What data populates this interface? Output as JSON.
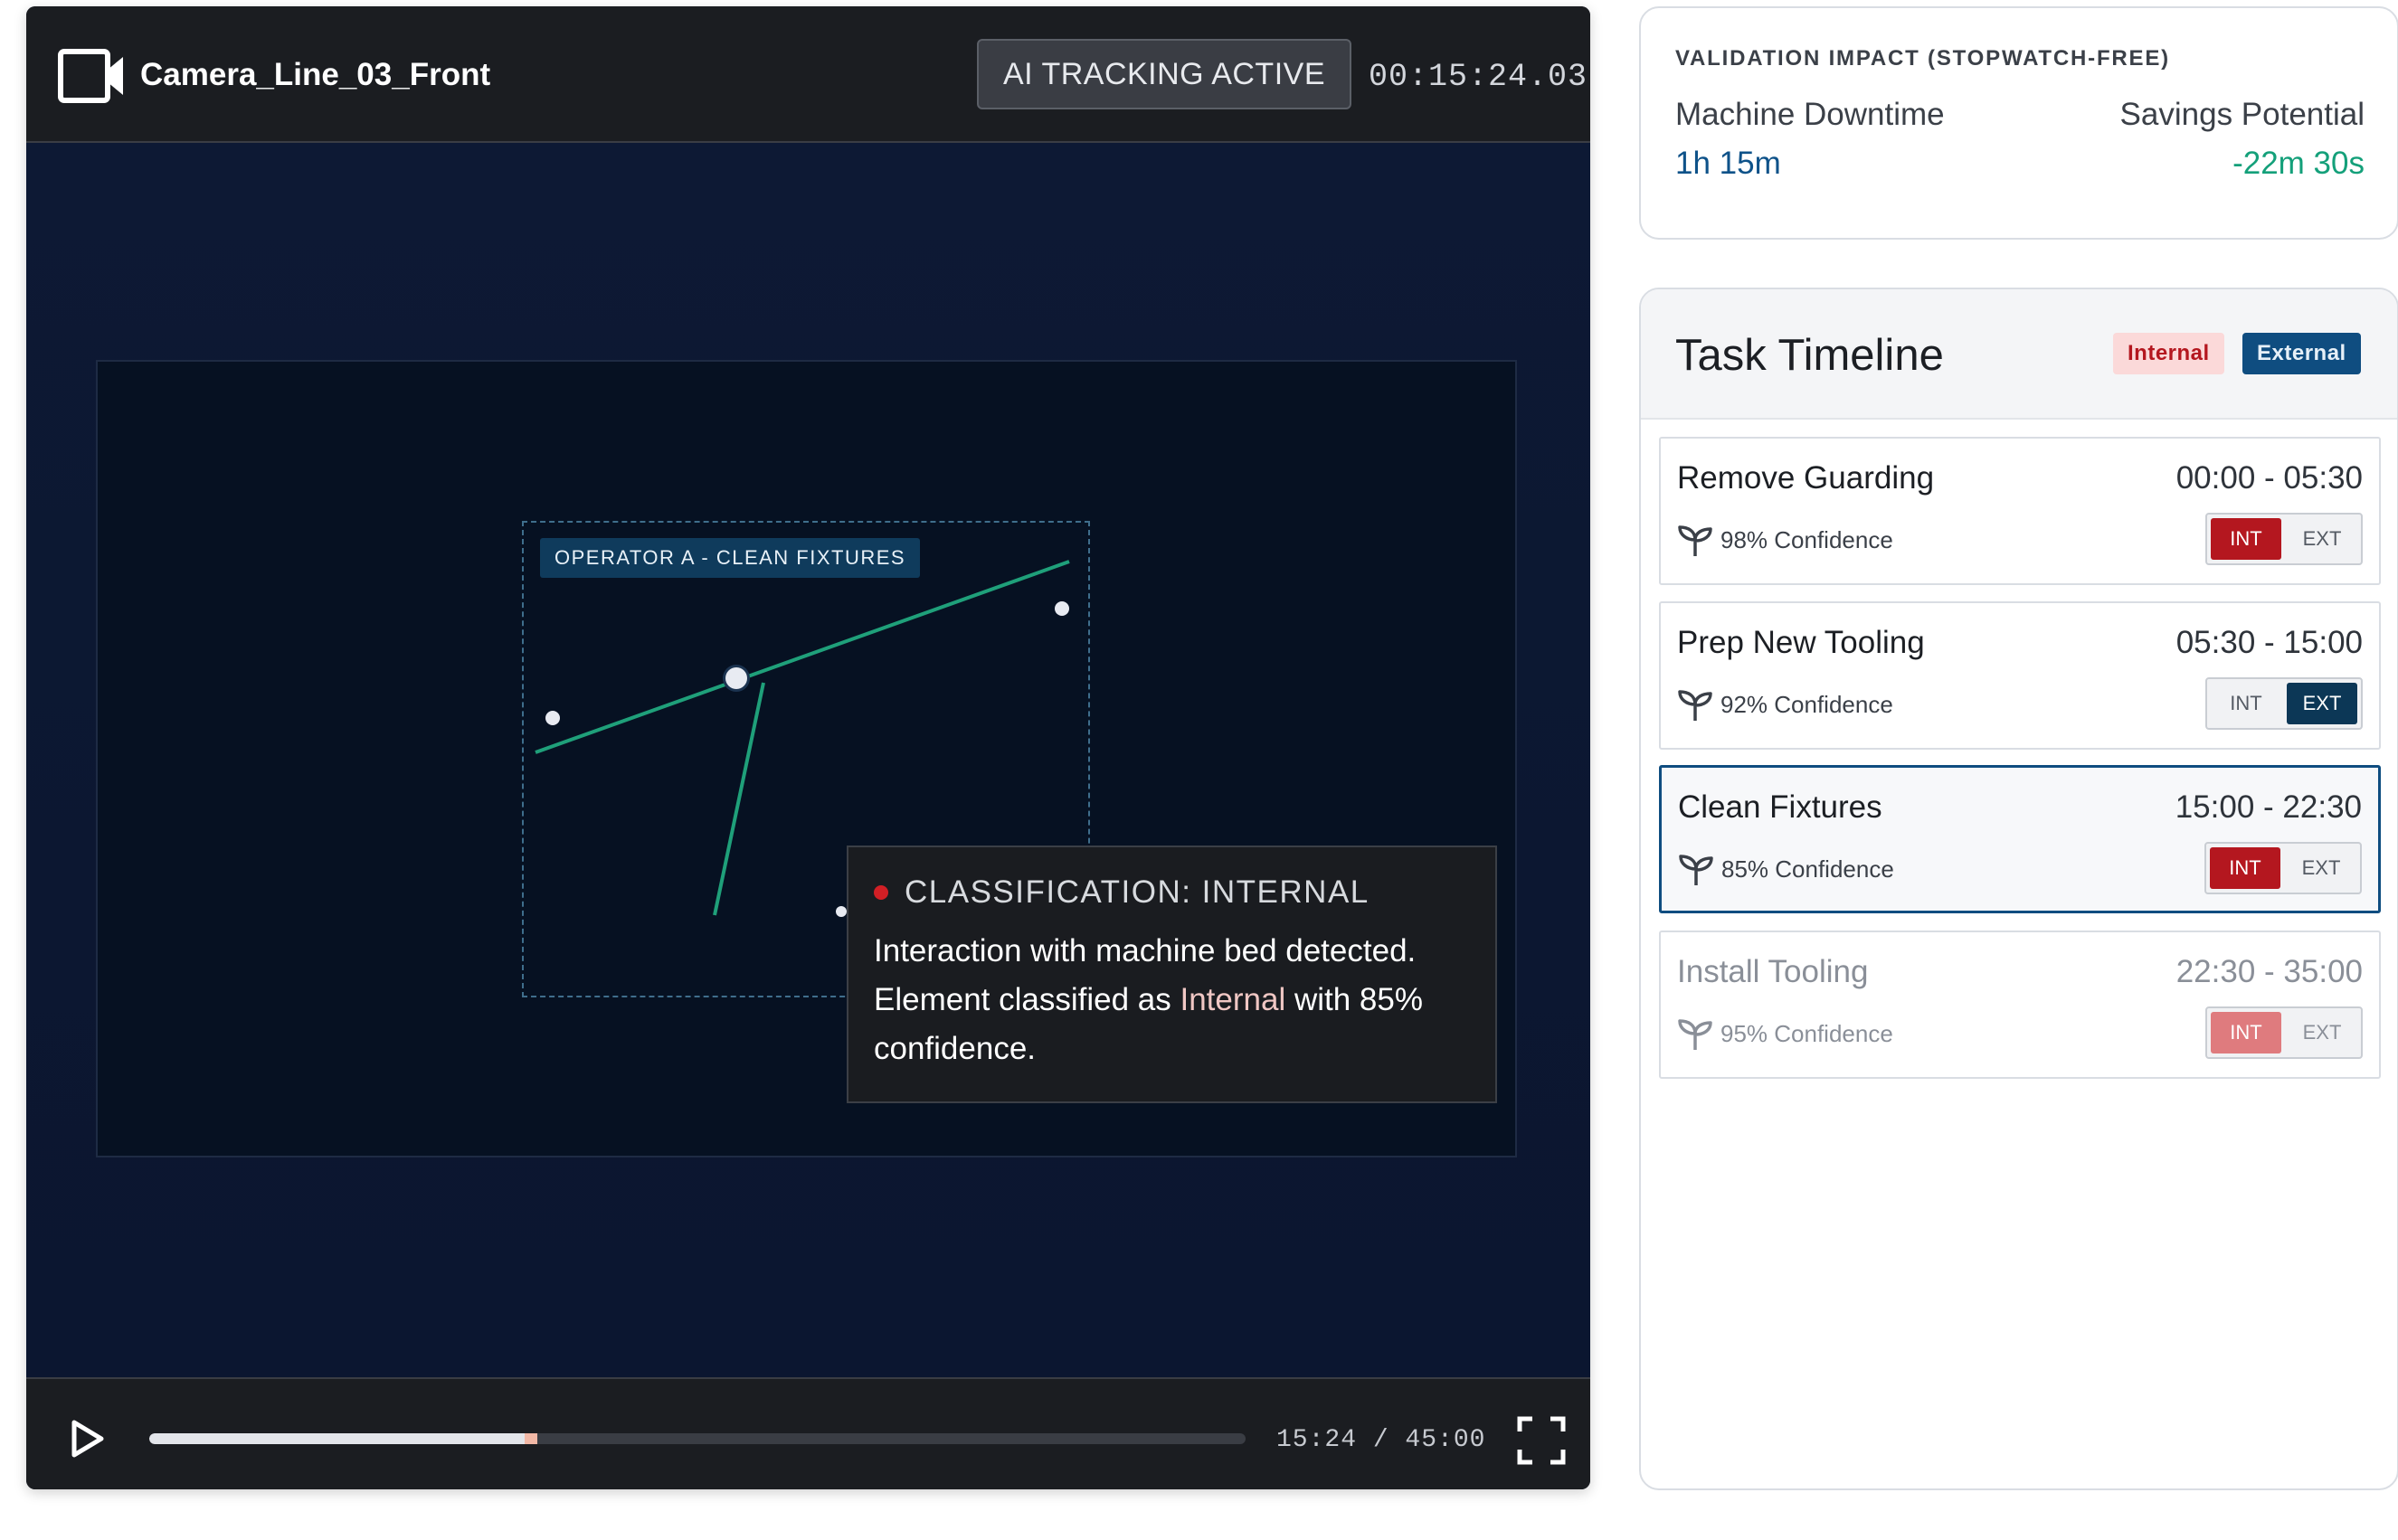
{
  "video": {
    "camera_title": "Camera_Line_03_Front",
    "ai_badge": "AI TRACKING ACTIVE",
    "timecode": "00:15:24.03",
    "operator_label": "OPERATOR A - CLEAN FIXTURES",
    "classification": {
      "heading": "CLASSIFICATION: INTERNAL",
      "line1": "Interaction with machine bed detected.",
      "line2_prefix": "Element classified as ",
      "line2_highlight": "Internal",
      "line2_suffix": " with 85%",
      "line3": "confidence."
    },
    "playback": {
      "current": "15:24",
      "total": "45:00",
      "readout": "15:24 / 45:00",
      "progress_fraction": 0.342
    }
  },
  "validation": {
    "title": "VALIDATION IMPACT (STOPWATCH-FREE)",
    "downtime_label": "Machine Downtime",
    "downtime_value": "1h 15m",
    "savings_label": "Savings Potential",
    "savings_value": "-22m 30s"
  },
  "timeline": {
    "title": "Task Timeline",
    "legend_internal": "Internal",
    "legend_external": "External",
    "tasks": [
      {
        "name": "Remove Guarding",
        "time": "00:00 - 05:30",
        "confidence": "98% Confidence",
        "int_label": "INT",
        "ext_label": "EXT",
        "selected": "INT"
      },
      {
        "name": "Prep New Tooling",
        "time": "05:30 - 15:00",
        "confidence": "92% Confidence",
        "int_label": "INT",
        "ext_label": "EXT",
        "selected": "EXT"
      },
      {
        "name": "Clean Fixtures",
        "time": "15:00 - 22:30",
        "confidence": "85% Confidence",
        "int_label": "INT",
        "ext_label": "EXT",
        "selected": "INT"
      },
      {
        "name": "Install Tooling",
        "time": "22:30 - 35:00",
        "confidence": "95% Confidence",
        "int_label": "INT",
        "ext_label": "EXT",
        "selected": "INT"
      }
    ]
  },
  "colors": {
    "internal": "#b4171f",
    "external": "#0f4d80",
    "savings": "#14a07a",
    "tracking_line": "#1fa07a"
  }
}
